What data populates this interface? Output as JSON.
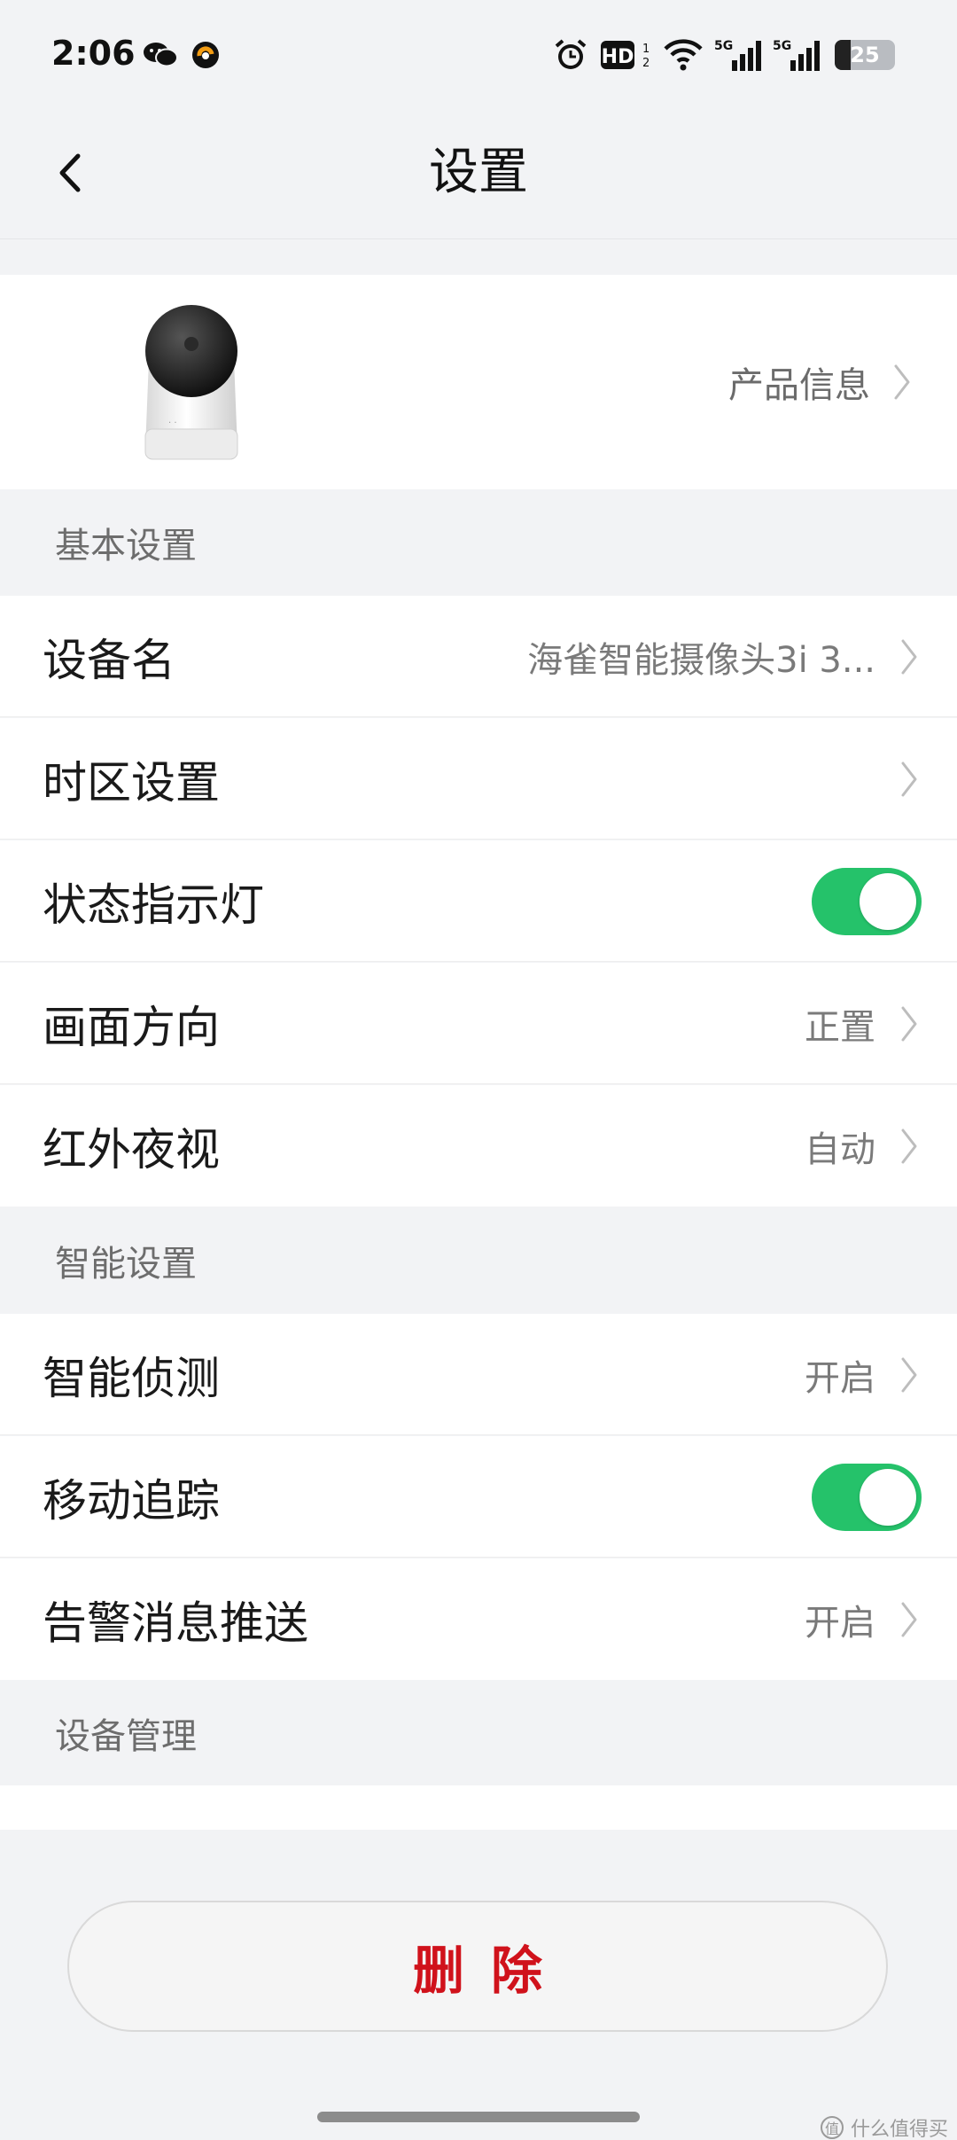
{
  "status_bar": {
    "time": "2:06",
    "icons": [
      "wechat-icon",
      "app-icon",
      "alarm-icon",
      "hd-icon",
      "wifi-icon",
      "signal-5g-icon",
      "signal-5g-icon",
      "battery-icon"
    ],
    "hd_label": "HD",
    "network_label": "5G",
    "battery_level": "25"
  },
  "header": {
    "title": "设置",
    "back_icon": "chevron-left-icon"
  },
  "product": {
    "info_label": "产品信息",
    "image_name": "camera-image"
  },
  "sections": {
    "basic": {
      "title": "基本设置",
      "rows": [
        {
          "label": "设备名",
          "value": "海雀智能摄像头3i 3...",
          "control": "chevron"
        },
        {
          "label": "时区设置",
          "value": "",
          "control": "chevron"
        },
        {
          "label": "状态指示灯",
          "control": "toggle",
          "on": true
        },
        {
          "label": "画面方向",
          "value": "正置",
          "control": "chevron"
        },
        {
          "label": "红外夜视",
          "value": "自动",
          "control": "chevron"
        }
      ]
    },
    "smart": {
      "title": "智能设置",
      "rows": [
        {
          "label": "智能侦测",
          "value": "开启",
          "control": "chevron"
        },
        {
          "label": "移动追踪",
          "control": "toggle",
          "on": true
        },
        {
          "label": "告警消息推送",
          "value": "开启",
          "control": "chevron"
        }
      ]
    },
    "management": {
      "title": "设备管理"
    }
  },
  "footer": {
    "delete_label": "删除",
    "watermark": "什么值得买"
  },
  "colors": {
    "toggle_on": "#25c26a",
    "delete_text": "#d0121b",
    "background": "#f2f3f5"
  }
}
